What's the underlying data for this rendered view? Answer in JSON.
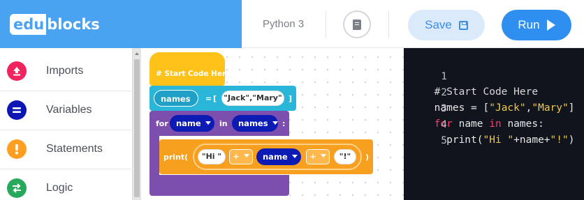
{
  "header": {
    "logo_part1": "edu",
    "logo_part2": "blocks",
    "python_version": "Python 3",
    "book_icon": "book-icon",
    "save_label": "Save",
    "run_label": "Run"
  },
  "categories": [
    {
      "label": "Imports",
      "color": "#f0245f",
      "icon": "upload-icon"
    },
    {
      "label": "Variables",
      "color": "#0e17b4",
      "icon": "equals-icon"
    },
    {
      "label": "Statements",
      "color": "#ff9f22",
      "icon": "exclamation-icon"
    },
    {
      "label": "Logic",
      "color": "#27a85b",
      "icon": "swap-arrows-icon"
    }
  ],
  "blocks": {
    "comment": "# Start Code Here",
    "assign": {
      "var": "names",
      "equals": "=",
      "open": "[",
      "list_value": "\"Jack\",\"Mary\"",
      "close": "]"
    },
    "for_loop": {
      "for": "for",
      "var": "name",
      "in": "in",
      "iter": "names",
      "colon": ":"
    },
    "print_stmt": {
      "func": "print(",
      "str1": "\"Hi \"",
      "op1": "+",
      "var": "name",
      "op2": "+",
      "str2": "\"!\"",
      "close": ")"
    }
  },
  "editor": {
    "lines": [
      {
        "num": "1",
        "text": "# Start Code Here"
      },
      {
        "num": "2",
        "text": "names = [\"Jack\",\"Mary\"]"
      },
      {
        "num": "3",
        "text": "for name in names:"
      },
      {
        "num": "4",
        "text": "  print(\"Hi \"+name+\"!\")"
      },
      {
        "num": "5",
        "text": ""
      }
    ]
  },
  "colors": {
    "brand": "#4aa3f0",
    "comment_block": "#ffc21a",
    "variable_block": "#29b6d8",
    "loop_block": "#7c4fae",
    "print_block": "#f7a01f",
    "variable_pill": "#0d1bb5",
    "editor_bg": "#10141c"
  }
}
